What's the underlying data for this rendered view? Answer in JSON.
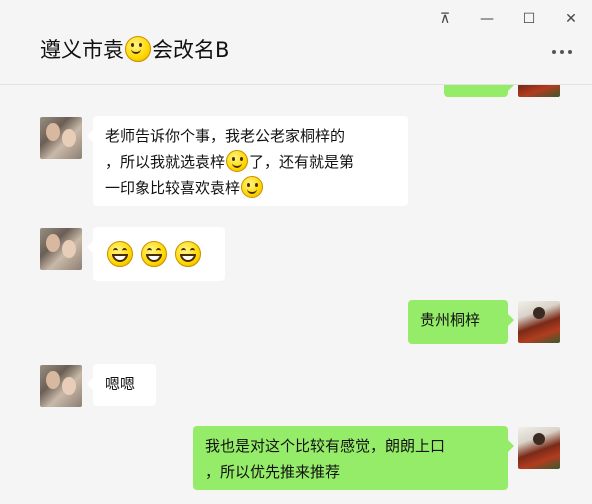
{
  "window": {
    "controls": {
      "pin_glyph": "⊼",
      "minimize_glyph": "—",
      "maximize_glyph": "☐",
      "close_glyph": "✕"
    }
  },
  "header": {
    "title_part1": "遵义市袁",
    "title_part2": "会改名B",
    "title_emoji": "smile-emoji"
  },
  "messages": [
    {
      "side": "right",
      "text": ""
    },
    {
      "side": "left",
      "line1": "老师告诉你个事，我老公老家桐梓的",
      "line2a": "，所以我就选袁梓",
      "line2b": "了，还有就是第",
      "line3a": "一印象比较喜欢袁梓"
    },
    {
      "side": "left",
      "emojis": [
        "grin-emoji",
        "grin-emoji",
        "grin-emoji"
      ]
    },
    {
      "side": "right",
      "text": "贵州桐梓"
    },
    {
      "side": "left",
      "text": "嗯嗯"
    },
    {
      "side": "right",
      "line1": "我也是对这个比较有感觉，朗朗上口",
      "line2": "，所以优先推来推荐"
    }
  ],
  "colors": {
    "background": "#f5f5f5",
    "self_bubble": "#95ec69",
    "other_bubble": "#ffffff"
  }
}
